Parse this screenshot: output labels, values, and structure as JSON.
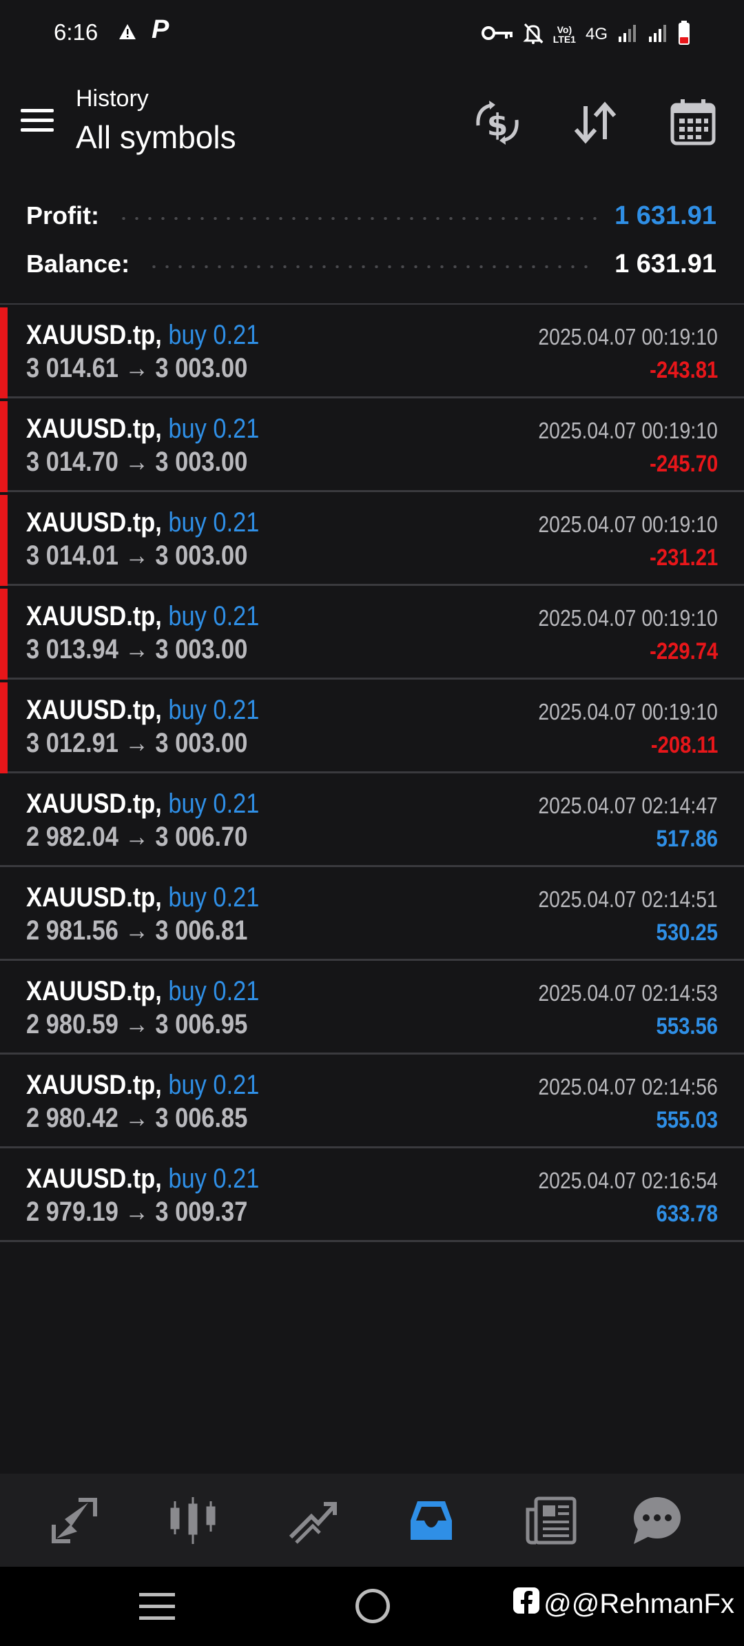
{
  "status_bar": {
    "time": "6:16",
    "network": "4G",
    "volte": "Vo)\nLTE1",
    "icons": [
      "warning-icon",
      "p-app-icon",
      "vpn-key-icon",
      "bell-off-icon",
      "volte-icon",
      "signal-icon",
      "signal-icon",
      "battery-low-icon"
    ]
  },
  "header": {
    "subtitle": "History",
    "title": "All symbols",
    "actions": [
      "currency-exchange-icon",
      "sort-icon",
      "calendar-icon"
    ]
  },
  "summary": {
    "profit_label": "Profit:",
    "profit_value": "1 631.91",
    "balance_label": "Balance:",
    "balance_value": "1 631.91"
  },
  "deals": [
    {
      "symbol": "XAUUSD.tp,",
      "side": "buy 0.21",
      "prices": "3 014.61 → 3 003.00",
      "time": "2025.04.07 00:19:10",
      "pl": "-243.81",
      "loss": true
    },
    {
      "symbol": "XAUUSD.tp,",
      "side": "buy 0.21",
      "prices": "3 014.70 → 3 003.00",
      "time": "2025.04.07 00:19:10",
      "pl": "-245.70",
      "loss": true
    },
    {
      "symbol": "XAUUSD.tp,",
      "side": "buy 0.21",
      "prices": "3 014.01 → 3 003.00",
      "time": "2025.04.07 00:19:10",
      "pl": "-231.21",
      "loss": true
    },
    {
      "symbol": "XAUUSD.tp,",
      "side": "buy 0.21",
      "prices": "3 013.94 → 3 003.00",
      "time": "2025.04.07 00:19:10",
      "pl": "-229.74",
      "loss": true
    },
    {
      "symbol": "XAUUSD.tp,",
      "side": "buy 0.21",
      "prices": "3 012.91 → 3 003.00",
      "time": "2025.04.07 00:19:10",
      "pl": "-208.11",
      "loss": true
    },
    {
      "symbol": "XAUUSD.tp,",
      "side": "buy 0.21",
      "prices": "2 982.04 → 3 006.70",
      "time": "2025.04.07 02:14:47",
      "pl": "517.86",
      "loss": false
    },
    {
      "symbol": "XAUUSD.tp,",
      "side": "buy 0.21",
      "prices": "2 981.56 → 3 006.81",
      "time": "2025.04.07 02:14:51",
      "pl": "530.25",
      "loss": false
    },
    {
      "symbol": "XAUUSD.tp,",
      "side": "buy 0.21",
      "prices": "2 980.59 → 3 006.95",
      "time": "2025.04.07 02:14:53",
      "pl": "553.56",
      "loss": false
    },
    {
      "symbol": "XAUUSD.tp,",
      "side": "buy 0.21",
      "prices": "2 980.42 → 3 006.85",
      "time": "2025.04.07 02:14:56",
      "pl": "555.03",
      "loss": false
    },
    {
      "symbol": "XAUUSD.tp,",
      "side": "buy 0.21",
      "prices": "2 979.19 → 3 009.37",
      "time": "2025.04.07 02:16:54",
      "pl": "633.78",
      "loss": false
    }
  ],
  "bottom_nav": {
    "items": [
      "quotes-icon",
      "chart-icon",
      "trade-icon",
      "history-icon",
      "news-icon",
      "messages-icon"
    ],
    "active": "history-icon"
  },
  "watermark": "@@RehmanFx",
  "colors": {
    "background": "#151517",
    "accent_blue": "#2f8fe6",
    "loss_red": "#e8161a",
    "muted_text": "#b9b9bd"
  }
}
